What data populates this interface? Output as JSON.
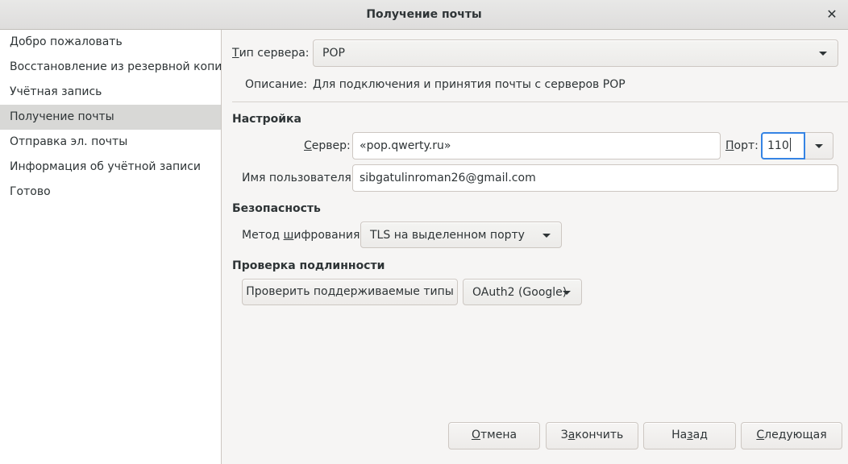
{
  "window": {
    "title": "Получение почты",
    "close_glyph": "✕"
  },
  "sidebar": {
    "items": [
      {
        "label": "Добро пожаловать"
      },
      {
        "label": "Восстановление из резервной копии"
      },
      {
        "label": "Учётная запись"
      },
      {
        "label": "Получение почты",
        "active": true
      },
      {
        "label": "Отправка эл. почты"
      },
      {
        "label": "Информация об учётной записи"
      },
      {
        "label": "Готово"
      }
    ]
  },
  "form": {
    "server_type": {
      "label_pre": "Т",
      "label_rest": "ип сервера:",
      "value": "POP"
    },
    "description": {
      "label": "Описание:",
      "value": "Для подключения и принятия почты с серверов POP"
    },
    "settings": {
      "heading": "Настройка",
      "server": {
        "label_pre": "С",
        "label_rest": "ервер:",
        "value": "«pop.qwerty.ru»"
      },
      "port": {
        "label_pre": "П",
        "label_rest": "орт:",
        "value": "110"
      },
      "username": {
        "label": "Имя пользователя:",
        "value": "sibgatulinroman26@gmail.com"
      }
    },
    "security": {
      "heading": "Безопасность",
      "encryption": {
        "label_pre": "Метод ",
        "label_u": "ш",
        "label_rest": "ифрования:",
        "value": "TLS на выделенном порту"
      }
    },
    "auth": {
      "heading": "Проверка подлинности",
      "check_button": "Проверить поддерживаемые типы",
      "method": "OAuth2 (Google)"
    }
  },
  "buttons": {
    "cancel": {
      "u": "О",
      "rest": "тмена"
    },
    "finish": {
      "pre": "З",
      "u": "а",
      "rest": "кончить"
    },
    "back": {
      "pre": "На",
      "u": "з",
      "rest": "ад"
    },
    "next": {
      "u": "С",
      "rest": "ледующая"
    }
  },
  "colors": {
    "accent": "#3584e4",
    "sidebar_active": "#d8d8d6"
  }
}
